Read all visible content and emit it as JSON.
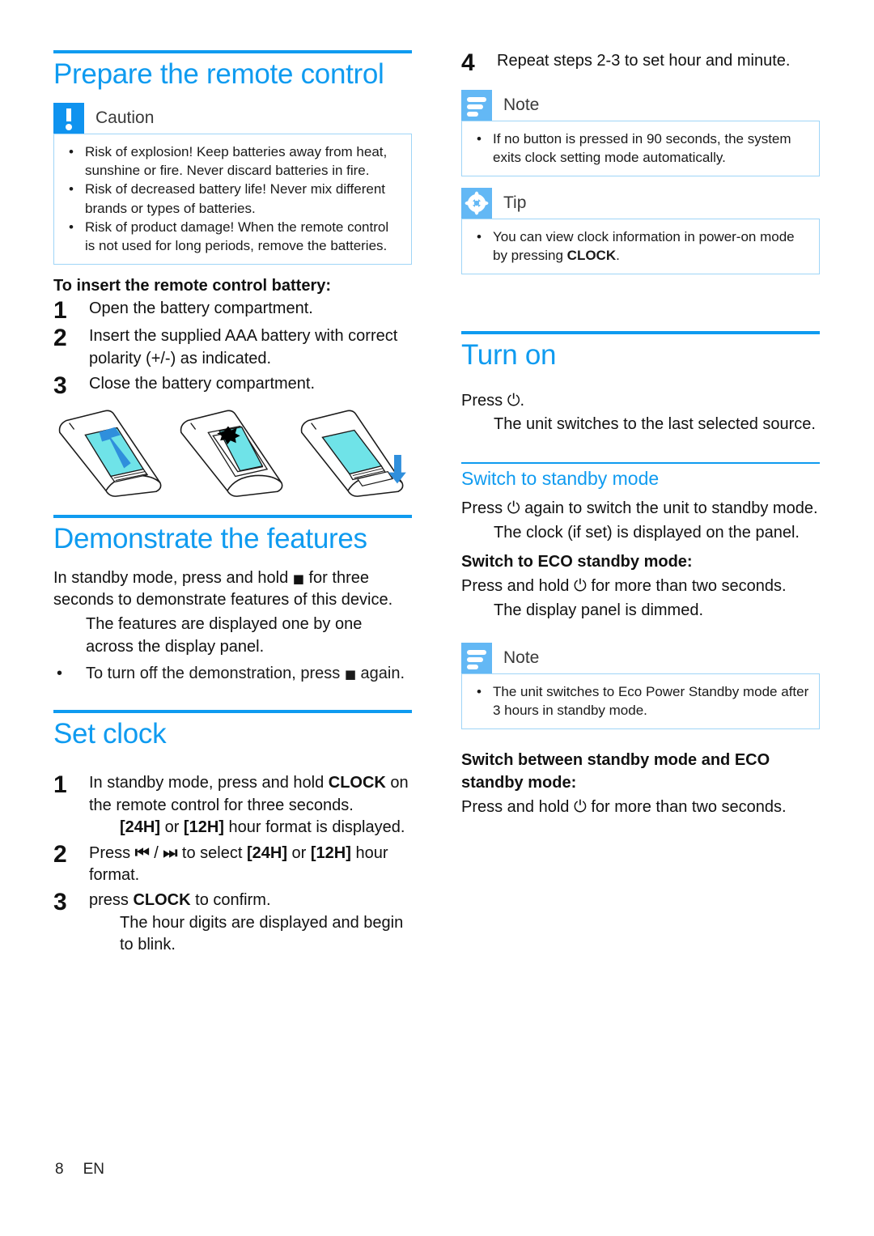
{
  "page": {
    "number": "8",
    "language": "EN"
  },
  "left_column": {
    "section1": {
      "title": "Prepare the remote control",
      "caution": {
        "label": "Caution",
        "icon": "exclamation-icon",
        "items": [
          "Risk of explosion! Keep batteries away from heat, sunshine or fire. Never discard batteries in fire.",
          "Risk of decreased battery life! Never mix different brands or types of batteries.",
          "Risk of product damage! When the remote control is not used for long periods, remove the batteries."
        ]
      },
      "lead": "To insert the remote control battery:",
      "steps": [
        {
          "num": "1",
          "text": "Open the battery compartment."
        },
        {
          "num": "2",
          "text": "Insert the supplied AAA battery with correct polarity (+/-) as indicated."
        },
        {
          "num": "3",
          "text": "Close the battery compartment."
        }
      ],
      "illustrations": [
        {
          "name": "remote-open-compartment",
          "caption": ""
        },
        {
          "name": "remote-insert-battery",
          "caption": ""
        },
        {
          "name": "remote-close-compartment",
          "caption": ""
        }
      ]
    },
    "section2": {
      "title": "Demonstrate the features",
      "intro_before": "In standby mode, press and hold ",
      "intro_symbol": "■",
      "intro_after": " for three seconds to demonstrate features of this device.",
      "result": "The features are displayed one by one across the display panel.",
      "bullet_before": "To turn off the demonstration, press ",
      "bullet_symbol": "■",
      "bullet_after": " again."
    },
    "section3": {
      "title": "Set clock",
      "steps": [
        {
          "num": "1",
          "text_before": "In standby mode, press and hold ",
          "bold": "CLOCK",
          "text_after": " on the remote control for three seconds.",
          "result_before": "",
          "result_bold1": "[24H]",
          "result_mid": " or ",
          "result_bold2": "[12H]",
          "result_after": " hour format is displayed."
        },
        {
          "num": "2",
          "text_before": "Press ",
          "symbol1": "⏮",
          "text_mid": " / ",
          "symbol2": "⏭",
          "text_after1": " to select ",
          "bold1": "[24H]",
          "text_after2": " or ",
          "bold2": "[12H]",
          "text_after3": " hour format."
        },
        {
          "num": "3",
          "text_before": "press ",
          "bold": "CLOCK",
          "text_after": " to confirm.",
          "result": "The hour digits are displayed and begin to blink."
        }
      ]
    }
  },
  "right_column": {
    "step4": {
      "num": "4",
      "text": "Repeat steps 2-3 to set hour and minute."
    },
    "note1": {
      "label": "Note",
      "icon": "note-lines-icon",
      "items": [
        "If no button is pressed in 90 seconds, the system exits clock setting mode automatically."
      ]
    },
    "tip1": {
      "label": "Tip",
      "icon": "asterisk-icon",
      "item_before": "You can view clock information in power-on mode by pressing ",
      "item_bold": "CLOCK",
      "item_after": "."
    },
    "section_turn_on": {
      "title": "Turn on",
      "press_before": "Press ",
      "press_symbol": "⏻",
      "press_after": ".",
      "result": "The unit switches to the last selected source."
    },
    "section_standby": {
      "title": "Switch to standby mode",
      "press_before": "Press ",
      "press_symbol": "⏻",
      "press_after": " again to switch the unit to standby mode.",
      "result": "The clock (if set) is displayed on the panel.",
      "eco_heading": "Switch to ECO standby mode:",
      "eco_before": "Press and hold ",
      "eco_symbol": "⏻",
      "eco_after": " for more than two seconds.",
      "eco_result": "The display panel is dimmed."
    },
    "note2": {
      "label": "Note",
      "icon": "note-lines-icon",
      "items": [
        "The unit switches to Eco Power Standby mode after 3 hours in standby mode."
      ]
    },
    "section_between": {
      "heading_line1": "Switch between standby mode and ECO",
      "heading_line2": "standby mode:",
      "text_before": "Press and hold ",
      "text_symbol": "⏻",
      "text_after": " for more than two seconds."
    }
  },
  "colors": {
    "accent_blue": "#0f9bf0",
    "icon_blue_strong": "#0f93ef",
    "icon_blue_light": "#63b8f5",
    "callout_border": "#9fd5f7",
    "illustration_cyan": "#6fe3e8",
    "illustration_arrow": "#2f8fdc"
  }
}
